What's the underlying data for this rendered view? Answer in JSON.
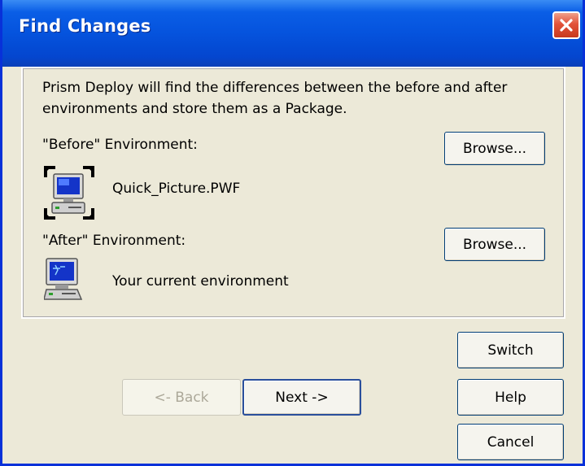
{
  "window": {
    "title": "Find Changes"
  },
  "intro": {
    "line1": "Prism Deploy will find the differences between the before and after",
    "line2": "environments and store them as a Package."
  },
  "before": {
    "label": "\"Before\" Environment:",
    "browse_label": "Browse...",
    "file_name": "Quick_Picture.PWF",
    "icon": "package-computer-icon"
  },
  "after": {
    "label": "\"After\" Environment:",
    "browse_label": "Browse...",
    "file_name": "Your current environment",
    "icon": "computer-icon"
  },
  "buttons": {
    "switch": "Switch",
    "back": "<- Back",
    "next": "Next ->",
    "help": "Help",
    "cancel": "Cancel"
  },
  "colors": {
    "titlebar": "#0553dd",
    "face": "#ece9d8",
    "close": "#e2523a"
  }
}
